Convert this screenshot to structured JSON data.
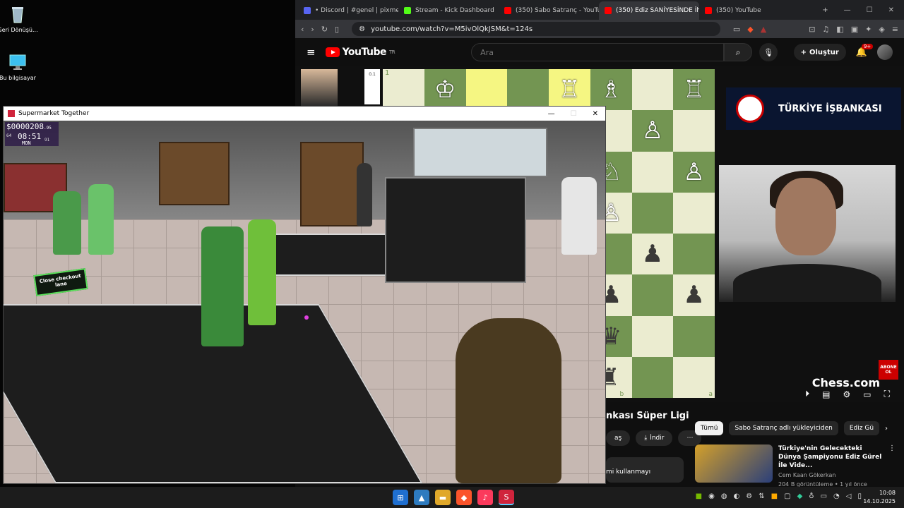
{
  "desktop": {
    "icons": [
      {
        "label": "Geri Dönüşü...",
        "icon": "recycle-bin-icon"
      },
      {
        "label": "Bu bilgisayar",
        "icon": "computer-icon"
      }
    ]
  },
  "browser": {
    "tabs": [
      {
        "label": "• Discord | #genel | pixmens",
        "icon": "discord-icon",
        "color": "#5865f2"
      },
      {
        "label": "Stream - Kick Dashboard",
        "icon": "kick-icon",
        "color": "#53fc18"
      },
      {
        "label": "(350) Sabo Satranç - YouTube",
        "icon": "youtube-icon",
        "color": "#ff0000"
      },
      {
        "label": "(350) Ediz SANİYESİNDE İh",
        "icon": "youtube-icon",
        "color": "#ff0000",
        "active": true
      },
      {
        "label": "(350) YouTube",
        "icon": "youtube-icon",
        "color": "#ff0000"
      }
    ],
    "url": "youtube.com/watch?v=M5ivOlQkJSM&t=124s"
  },
  "youtube": {
    "logo_text": "YouTube",
    "region": "TR",
    "search_placeholder": "Ara",
    "create_label": "Oluştur",
    "notif_count": "9+",
    "video_title": "nkası Süper Ligi",
    "actions": [
      "aş",
      "İndir",
      "⋯"
    ],
    "desc_text": "mi kullanmayı",
    "chips": [
      "Tümü",
      "Sabo Satranç adlı yükleyiciden",
      "Ediz Gü"
    ],
    "recommendation": {
      "title": "Türkiye'nin Gelecekteki Dünya Şampiyonu Ediz Gürel İle Vide...",
      "channel": "Cem Kaan Gökerkan",
      "stats": "204 B görüntüleme • 1 yıl önce"
    },
    "sponsor": "TÜRKİYE İŞBANKASI",
    "brand": "Chess.com",
    "subscribe_badge": "ABONE OL",
    "board_file_labels": [
      "c",
      "b",
      "a"
    ],
    "player_rating_text": "0.1",
    "move_number": "1"
  },
  "game": {
    "window_title": "Supermarket Together",
    "money": "$0000208",
    "money_sup": ".95",
    "time": "08:51",
    "day": "MON",
    "side_left": "64",
    "side_right": "91",
    "sign_text": "Close checkout lane"
  },
  "taskbar": {
    "apps": [
      {
        "icon": "windows-start-icon",
        "color": "#3a8de0"
      },
      {
        "icon": "photos-icon",
        "color": "#2e7bbf"
      },
      {
        "icon": "file-explorer-icon",
        "color": "#f0c24a"
      },
      {
        "icon": "brave-browser-icon",
        "color": "#fb542b"
      },
      {
        "icon": "itunes-icon",
        "color": "#fb3a5c"
      },
      {
        "icon": "supermarket-together-icon",
        "color": "#d0243c",
        "active": true
      }
    ],
    "time": "10:08",
    "date": "14.10.2025"
  }
}
